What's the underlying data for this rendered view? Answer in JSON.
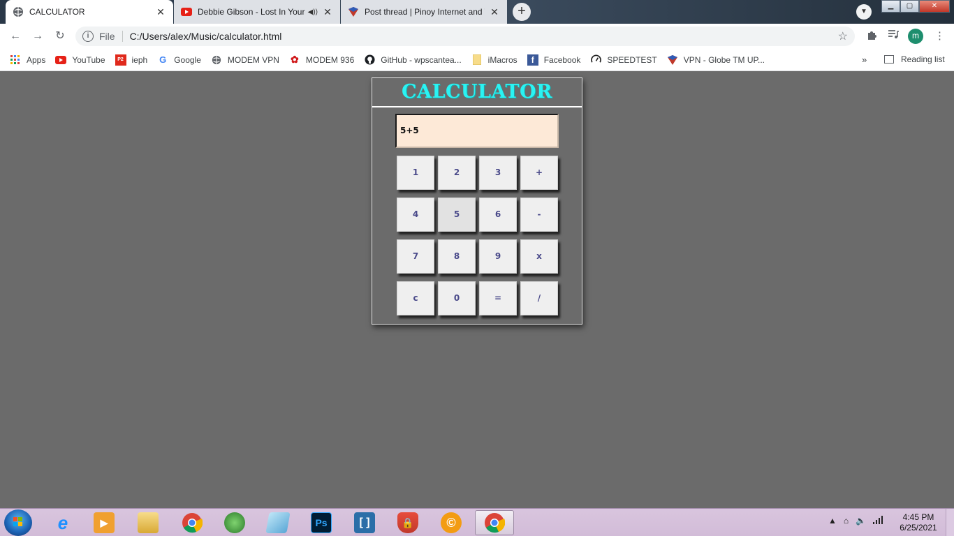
{
  "browser": {
    "tabs": [
      {
        "title": "CALCULATOR",
        "active": true,
        "favicon": "globe-icon"
      },
      {
        "title": "Debbie Gibson - Lost In Your Eyes",
        "active": false,
        "favicon": "youtube-icon",
        "audio": true
      },
      {
        "title": "Post thread | Pinoy Internet and Technology Forums",
        "active": false,
        "favicon": "pinoy-forum-icon"
      }
    ],
    "address": {
      "scheme_label": "File",
      "url": "C:/Users/alex/Music/calculator.html"
    },
    "profile_initial": "m",
    "bookmarks": [
      {
        "label": "Apps",
        "icon": "apps-grid-icon"
      },
      {
        "label": "YouTube",
        "icon": "youtube-icon"
      },
      {
        "label": "ieph",
        "icon": "ieph-icon"
      },
      {
        "label": "Google",
        "icon": "google-icon"
      },
      {
        "label": "MODEM VPN",
        "icon": "globe-icon"
      },
      {
        "label": "MODEM 936",
        "icon": "huawei-icon"
      },
      {
        "label": "GitHub - wpscantea...",
        "icon": "github-icon"
      },
      {
        "label": "iMacros",
        "icon": "folder-icon"
      },
      {
        "label": "Facebook",
        "icon": "facebook-icon"
      },
      {
        "label": "SPEEDTEST",
        "icon": "speedometer-icon"
      },
      {
        "label": "VPN - Globe TM UP...",
        "icon": "vpn-icon"
      }
    ],
    "bookmarks_overflow": "»",
    "reading_list": "Reading list"
  },
  "calculator": {
    "title": "CALCULATOR",
    "display": "5+5",
    "keys": [
      [
        "1",
        "2",
        "3",
        "+"
      ],
      [
        "4",
        "5",
        "6",
        "-"
      ],
      [
        "7",
        "8",
        "9",
        "x"
      ],
      [
        "c",
        "0",
        "=",
        "/"
      ]
    ],
    "pressed_key": "5"
  },
  "taskbar": {
    "apps": [
      "internet-explorer",
      "media-player",
      "file-explorer",
      "chrome",
      "green-app",
      "notepad-app",
      "photoshop",
      "brackets",
      "security-shield",
      "c-app",
      "chrome-active"
    ],
    "time": "4:45 PM",
    "date": "6/25/2021"
  },
  "colors": {
    "page_bg": "#6b6b6b",
    "title": "#2af3f3",
    "display_bg": "#fde9d7",
    "key_bg": "#efefef",
    "key_text": "#4a4a8a"
  }
}
